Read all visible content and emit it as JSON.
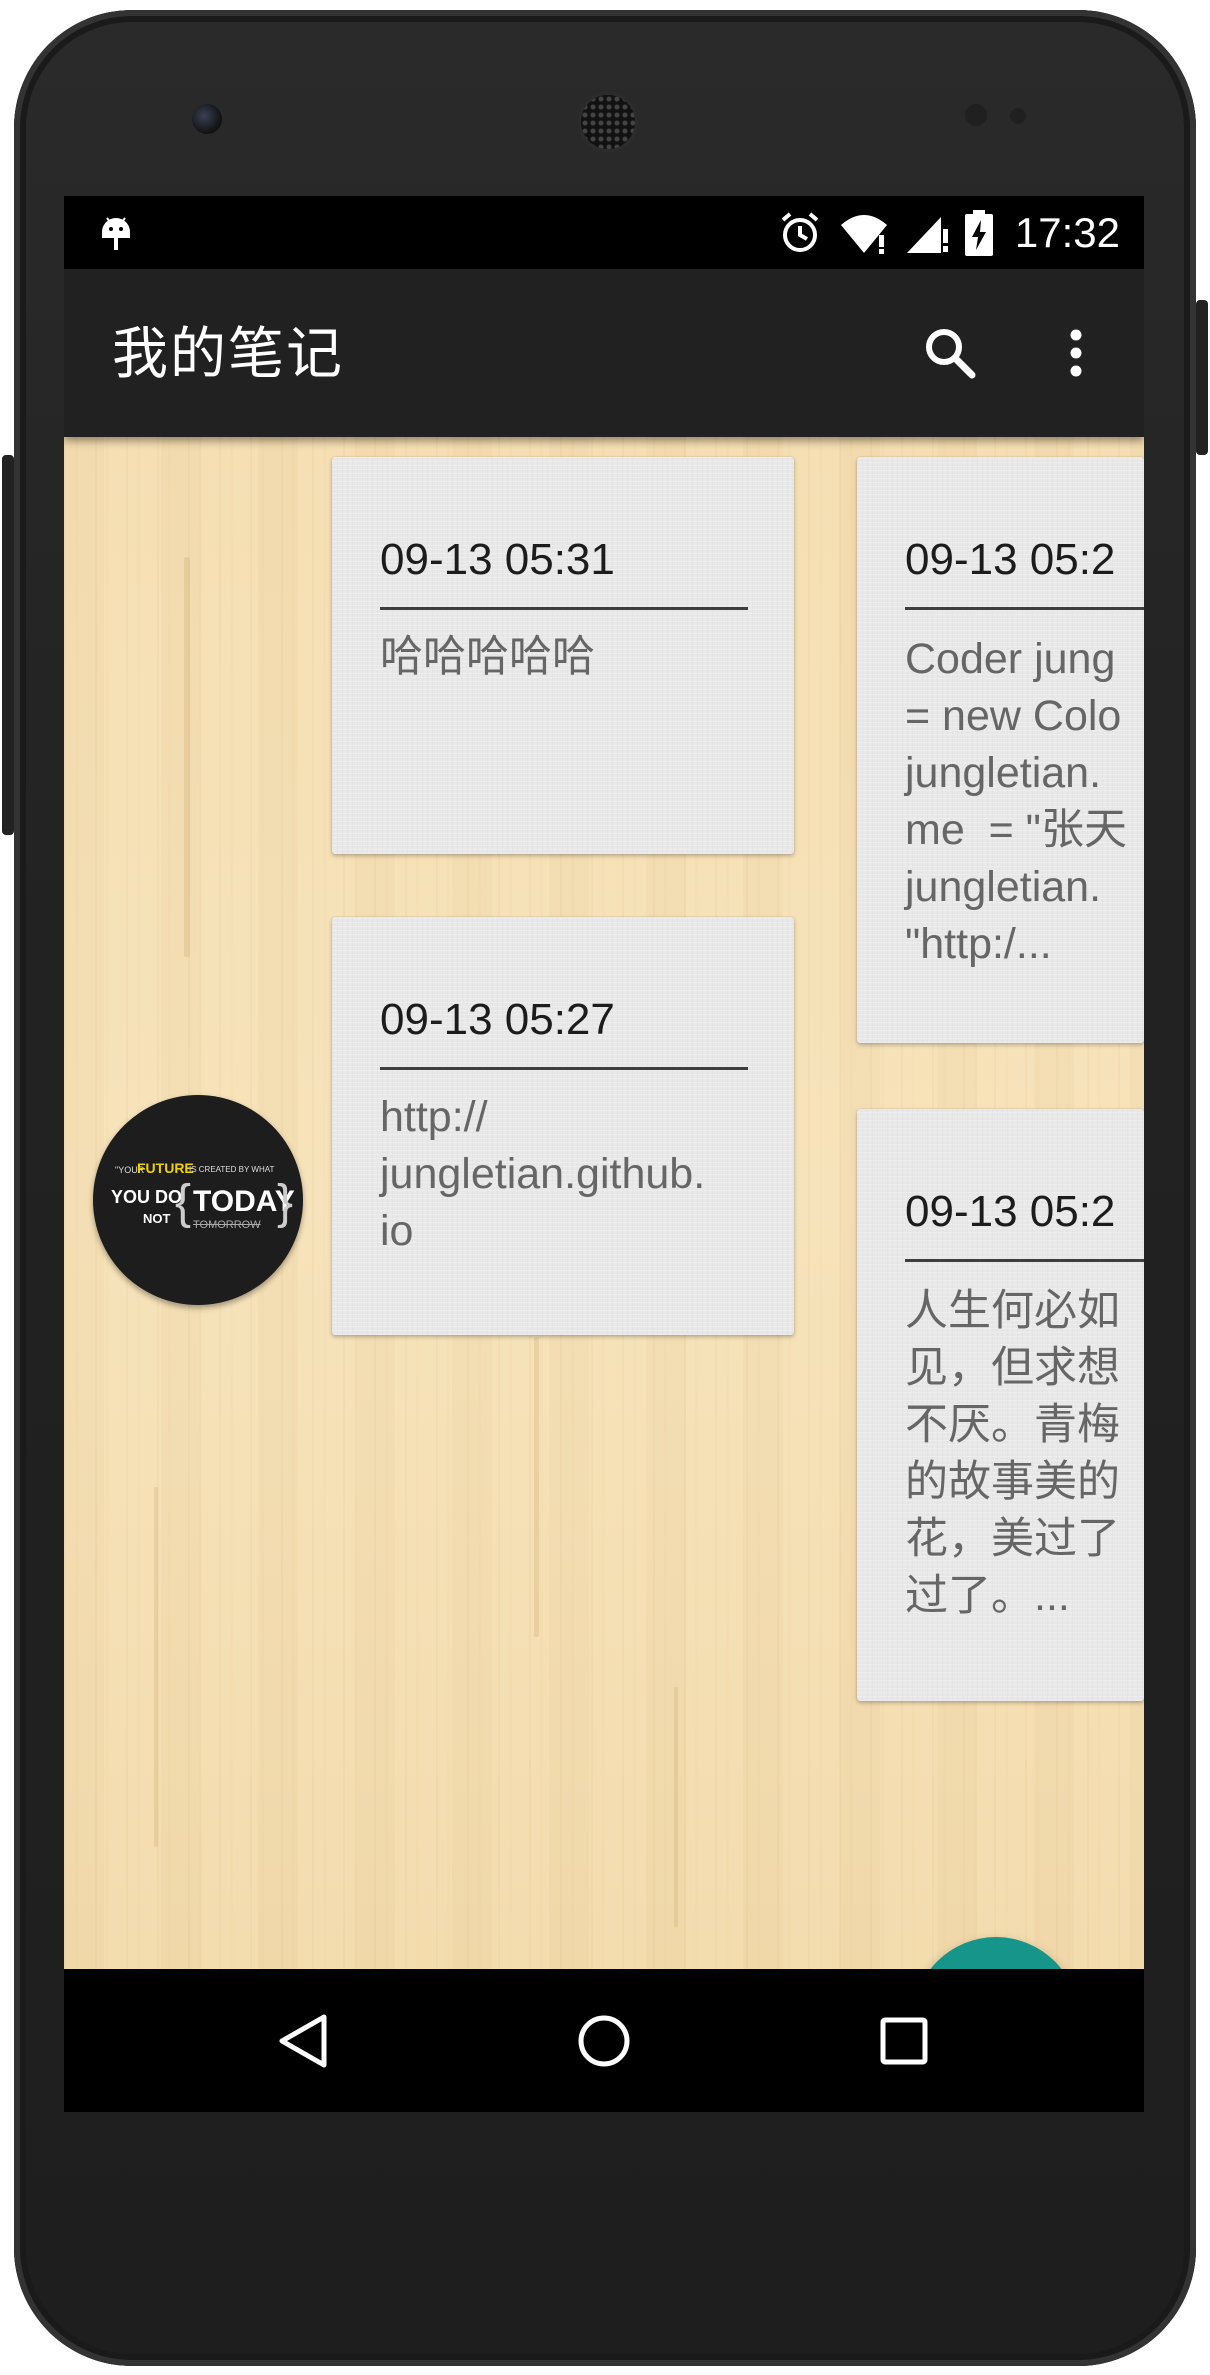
{
  "status_bar": {
    "time": "17:32",
    "icons": [
      "android-debug-icon",
      "alarm-icon",
      "wifi-icon",
      "cell-signal-icon",
      "battery-charging-icon"
    ]
  },
  "toolbar": {
    "title": "我的笔记",
    "actions": [
      "search-icon",
      "more-vert-icon"
    ]
  },
  "notes": [
    {
      "date": "09-13 05:31",
      "body": "哈哈哈哈哈"
    },
    {
      "date": "09-13 05:27",
      "body": "http://\njungletian.github.\nio"
    },
    {
      "date": "09-13 05:2",
      "body": "Coder jung\n= new Colo\njungletian.\nme  = \"张天\njungletian.\n\"http:/..."
    },
    {
      "date": "09-13 05:2",
      "body": "人生何必如\n见，但求想\n不厌。青梅\n的故事美的\n花，美过了\n过了。..."
    }
  ],
  "avatar": {
    "line1_prefix": "\"YOUR",
    "line1_highlight": "FUTURE",
    "line1_suffix": "IS CREATED BY WHAT",
    "line2a": "YOU DO",
    "line2b": "NOT",
    "today": "TODAY",
    "tomorrow": "TOMORROW"
  },
  "fab": {
    "icon": "note-add-icon"
  },
  "nav_bar": {
    "icons": [
      "back-icon",
      "home-icon",
      "recent-apps-icon"
    ]
  },
  "colors": {
    "toolbar": "#212121",
    "fab": "#16968a",
    "card": "#e8e8e8",
    "background_wood": "#f5dfb3",
    "avatar_highlight": "#f0d000"
  }
}
